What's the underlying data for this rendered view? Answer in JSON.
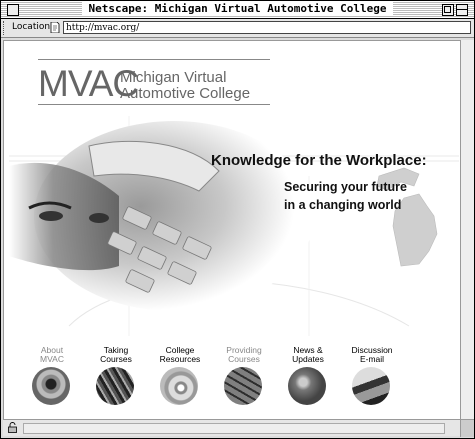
{
  "window": {
    "title": "Netscape: Michigan Virtual Automotive College"
  },
  "location": {
    "label": "Location:",
    "url": "http://mvac.org/"
  },
  "logo": {
    "acronym": "MVAC",
    "name_line1": "Michigan Virtual",
    "name_line2": "Automotive College"
  },
  "hero": {
    "headline": "Knowledge for the Workplace:",
    "subline1": "Securing your future",
    "subline2": "in a changing world"
  },
  "nav": [
    {
      "line1": "About",
      "line2": "MVAC",
      "icon": "eye-photo-icon"
    },
    {
      "line1": "Taking",
      "line2": "Courses",
      "icon": "wires-photo-icon"
    },
    {
      "line1": "College",
      "line2": "Resources",
      "icon": "cd-photo-icon"
    },
    {
      "line1": "Providing",
      "line2": "Courses",
      "icon": "keyboard-photo-icon"
    },
    {
      "line1": "News &",
      "line2": "Updates",
      "icon": "globe-photo-icon"
    },
    {
      "line1": "Discussion",
      "line2": "E-mail",
      "icon": "mail-photo-icon"
    }
  ]
}
